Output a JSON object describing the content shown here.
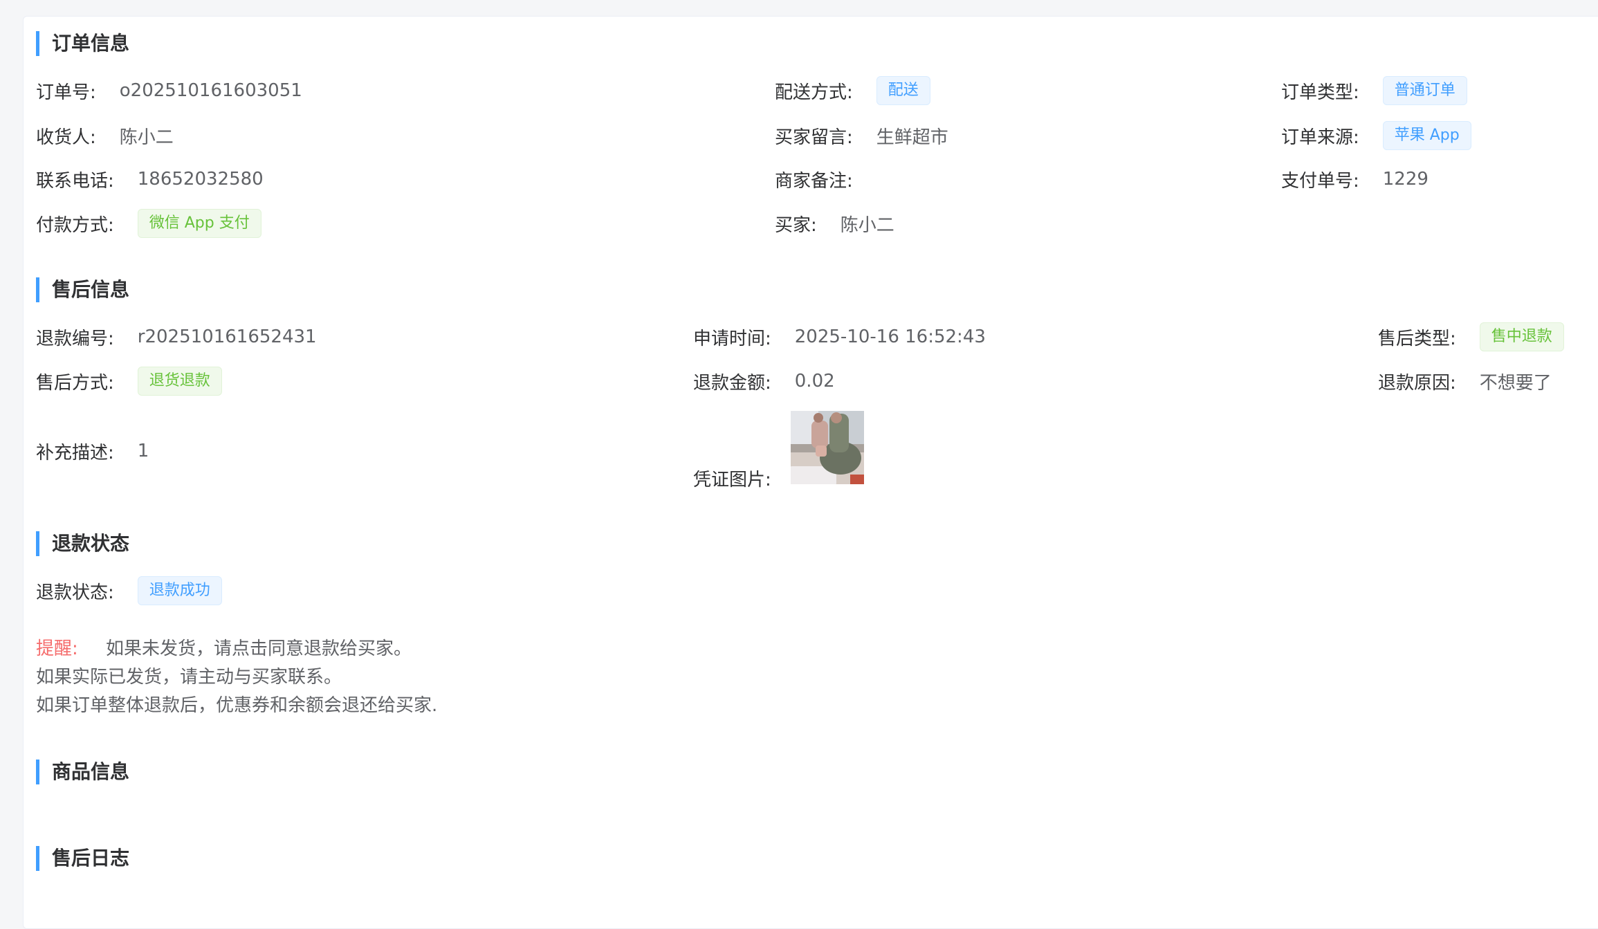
{
  "order_info": {
    "title": "订单信息",
    "order_no_label": "订单号:",
    "order_no": "o202510161603051",
    "delivery_label": "配送方式:",
    "delivery": "配送",
    "order_type_label": "订单类型:",
    "order_type": "普通订单",
    "receiver_label": "收货人:",
    "receiver": "陈小二",
    "buyer_msg_label": "买家留言:",
    "buyer_msg": "生鲜超市",
    "order_source_label": "订单来源:",
    "order_source": "苹果 App",
    "phone_label": "联系电话:",
    "phone": "18652032580",
    "merchant_note_label": "商家备注:",
    "pay_no_label": "支付单号:",
    "pay_no": "1229",
    "pay_method_label": "付款方式:",
    "pay_method": "微信 App 支付",
    "buyer_label": "买家:",
    "buyer": "陈小二"
  },
  "after_sale_info": {
    "title": "售后信息",
    "refund_no_label": "退款编号:",
    "refund_no": "r202510161652431",
    "apply_time_label": "申请时间:",
    "apply_time": "2025-10-16 16:52:43",
    "type_label": "售后类型:",
    "type": "售中退款",
    "method_label": "售后方式:",
    "method": "退货退款",
    "amount_label": "退款金额:",
    "amount": "0.02",
    "reason_label": "退款原因:",
    "reason": "不想要了",
    "desc_label": "补充描述:",
    "desc": "1",
    "proof_label": "凭证图片:"
  },
  "refund_status": {
    "title": "退款状态",
    "status_label": "退款状态:",
    "status": "退款成功"
  },
  "tips": {
    "warn_label": "提醒:",
    "line1": "如果未发货，请点击同意退款给买家。",
    "line2": "如果实际已发货，请主动与买家联系。",
    "line3": "如果订单整体退款后，优惠券和余额会退还给买家."
  },
  "goods_info": {
    "title": "商品信息"
  },
  "after_sale_log": {
    "title": "售后日志"
  },
  "colors": {
    "accent": "#409eff",
    "tag_blue": "#409eff",
    "tag_green": "#67c23a",
    "warn": "#f56c6c"
  }
}
